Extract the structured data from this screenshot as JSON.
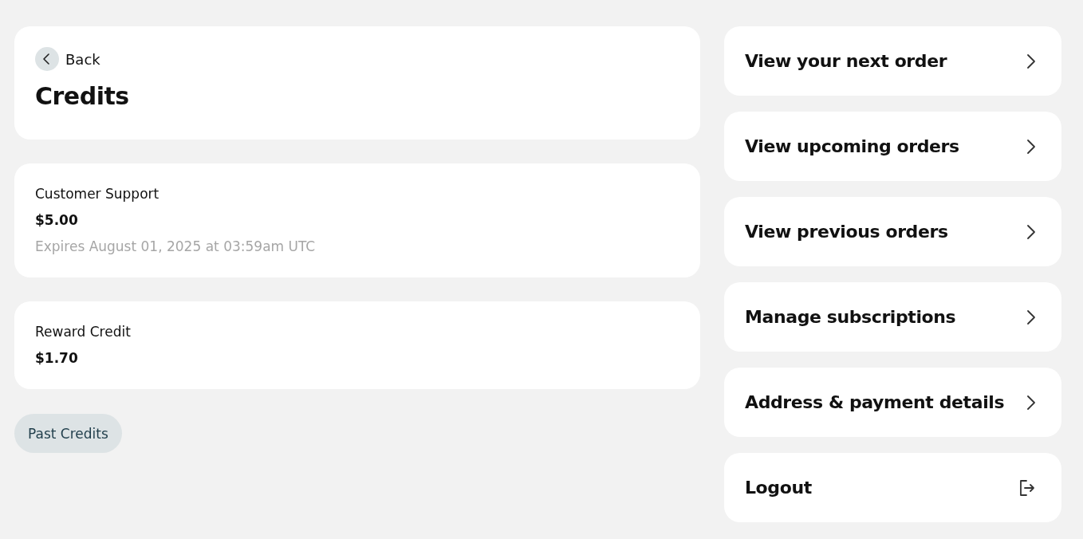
{
  "header": {
    "back": "Back",
    "title": "Credits"
  },
  "credits": [
    {
      "name": "Customer Support",
      "amount": "$5.00",
      "expiry": "Expires August 01, 2025 at 03:59am UTC"
    },
    {
      "name": "Reward Credit",
      "amount": "$1.70"
    }
  ],
  "past_credits_button": "Past Credits",
  "menu": [
    {
      "label": "View your next order",
      "kind": "link"
    },
    {
      "label": "View upcoming orders",
      "kind": "link"
    },
    {
      "label": "View previous orders",
      "kind": "link"
    },
    {
      "label": "Manage subscriptions",
      "kind": "link"
    },
    {
      "label": "Address & payment details",
      "kind": "link"
    },
    {
      "label": "Logout",
      "kind": "logout"
    }
  ]
}
